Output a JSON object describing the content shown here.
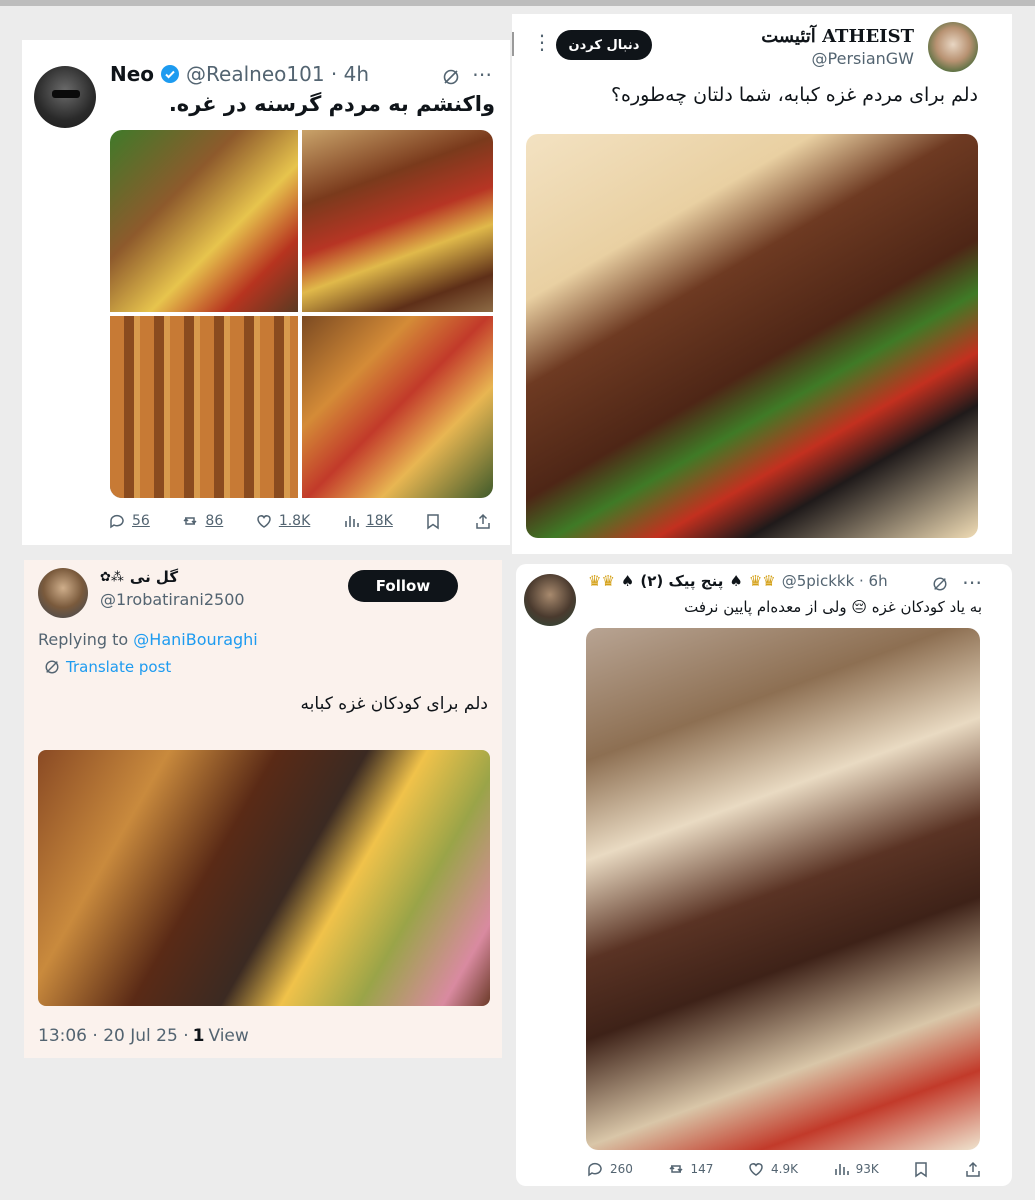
{
  "post_neo": {
    "name": "Neo",
    "handle": "@Realneo101 · 4h",
    "text": "واکنشم به مردم گرسنه در غره.",
    "actions": {
      "replies": "56",
      "reposts": "86",
      "likes": "1.8K",
      "views": "18K"
    },
    "verified_color": "#1d9bf0"
  },
  "post_atheist": {
    "name": "ATHEIST آتئیست",
    "handle": "@PersianGW",
    "follow_label": "دنبال کردن",
    "text": "دلم برای مردم غزه کبابه، شما دلتان چه‌طوره؟"
  },
  "post_golnei": {
    "name": "گل نی",
    "handle": "@1robatirani2500",
    "follow_label": "Follow",
    "replying_prefix": "Replying to",
    "replying_to": "@HaniBouraghi",
    "translate_label": "Translate post",
    "text": "دلم برای کودکان غزه کبابه",
    "timestamp": "13:06 · 20 Jul 25 ·",
    "views_count": "1",
    "views_label": "View",
    "bg_color": "#fbf2ed",
    "link_color": "#1d9bf0"
  },
  "post_5pick": {
    "name": "پنج پیک (۲)",
    "handle": "@5pickkk · 6h",
    "text": "به یاد کودکان غزه 😔 ولی از معده‌ام پایین نرفت",
    "actions": {
      "replies": "260",
      "reposts": "147",
      "likes": "4.9K",
      "views": "93K"
    }
  },
  "icons": [
    "grok-icon",
    "more-icon",
    "reply-icon",
    "repost-icon",
    "like-icon",
    "views-icon",
    "bookmark-icon",
    "share-icon",
    "verified-icon",
    "translate-icon"
  ]
}
